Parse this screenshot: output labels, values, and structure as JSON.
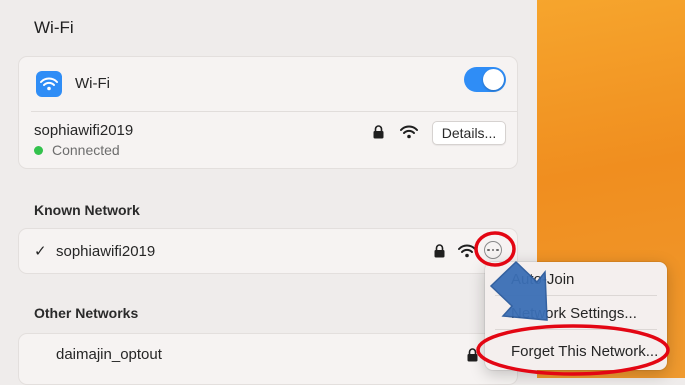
{
  "pane": {
    "title": "Wi-Fi"
  },
  "wifi_card": {
    "label": "Wi-Fi",
    "toggle_state": "on",
    "current_network": {
      "name": "sophiawifi2019",
      "status": "Connected",
      "details_label": "Details..."
    }
  },
  "known": {
    "title": "Known Network",
    "network_name": "sophiawifi2019",
    "checkmark": "✓"
  },
  "other": {
    "title": "Other Networks",
    "network_name": "daimajin_optout"
  },
  "menu": {
    "items": [
      {
        "label": "Auto-Join"
      },
      {
        "label": "Network Settings..."
      },
      {
        "label": "Forget This Network..."
      }
    ]
  },
  "colors": {
    "accent": "#2f8df6",
    "connected": "#33c24d",
    "annotation_red": "#e30613",
    "annotation_arrow": "#3b6fb6",
    "desktop": "#f6a52d"
  },
  "icons": {
    "wifi_badge": "wifi-icon",
    "lock": "lock-icon",
    "signal": "wifi-signal-icon",
    "more": "ellipsis-circle-icon"
  }
}
